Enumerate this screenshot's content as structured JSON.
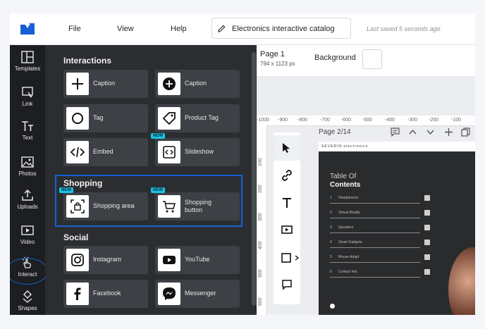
{
  "topbar": {
    "menu": [
      "File",
      "View",
      "Help"
    ],
    "doc_title": "Electronics interactive catalog",
    "saved_status": "Last saved 5 seconds ago"
  },
  "rail": {
    "items": [
      {
        "label": "Templates",
        "icon": "templates-icon"
      },
      {
        "label": "Link",
        "icon": "link-icon"
      },
      {
        "label": "Text",
        "icon": "text-icon"
      },
      {
        "label": "Photos",
        "icon": "photos-icon"
      },
      {
        "label": "Uploads",
        "icon": "uploads-icon"
      },
      {
        "label": "Video",
        "icon": "video-icon"
      },
      {
        "label": "Interact",
        "icon": "interact-icon"
      },
      {
        "label": "Shapes",
        "icon": "shapes-icon"
      }
    ]
  },
  "panel": {
    "sections": {
      "interactions": "Interactions",
      "shopping": "Shopping",
      "social": "Social"
    },
    "cards": {
      "caption_plus": "Caption",
      "caption_circle": "Caption",
      "tag": "Tag",
      "product_tag": "Product Tag",
      "embed": "Embed",
      "slideshow": "Slideshow",
      "shopping_area": "Shopping area",
      "shopping_button_line1": "Shopping",
      "shopping_button_line2": "button",
      "instagram": "Instagram",
      "youtube": "YouTube",
      "facebook": "Facebook",
      "messenger": "Messenger"
    },
    "new_badge": "NEW"
  },
  "canvas": {
    "page_name": "Page 1",
    "page_size": "794 x 1123 px",
    "background_label": "Background",
    "page_counter": "Page 2/14",
    "ruler_h": [
      "-1000",
      "-900",
      "-800",
      "-700",
      "-600",
      "-500",
      "-400",
      "-300",
      "-200",
      "-100"
    ],
    "ruler_v": [
      "100",
      "200",
      "300",
      "400",
      "500",
      "600"
    ]
  },
  "document": {
    "brand": "SEVERIN electronics",
    "toc_line1": "Table Of",
    "toc_line2": "Contents",
    "toc": [
      {
        "n": "1",
        "t": "Headphones"
      },
      {
        "n": "2",
        "t": "Virtual Reality"
      },
      {
        "n": "3",
        "t": "Speakers"
      },
      {
        "n": "4",
        "t": "Smart Gadgets"
      },
      {
        "n": "5",
        "t": "Mouse Adapt"
      },
      {
        "n": "6",
        "t": "Contact info"
      }
    ]
  },
  "colors": {
    "highlight": "#1760d4",
    "new_badge": "#19c4e8",
    "panel_bg": "#2b2d31",
    "rail_bg": "#1c1e21"
  }
}
